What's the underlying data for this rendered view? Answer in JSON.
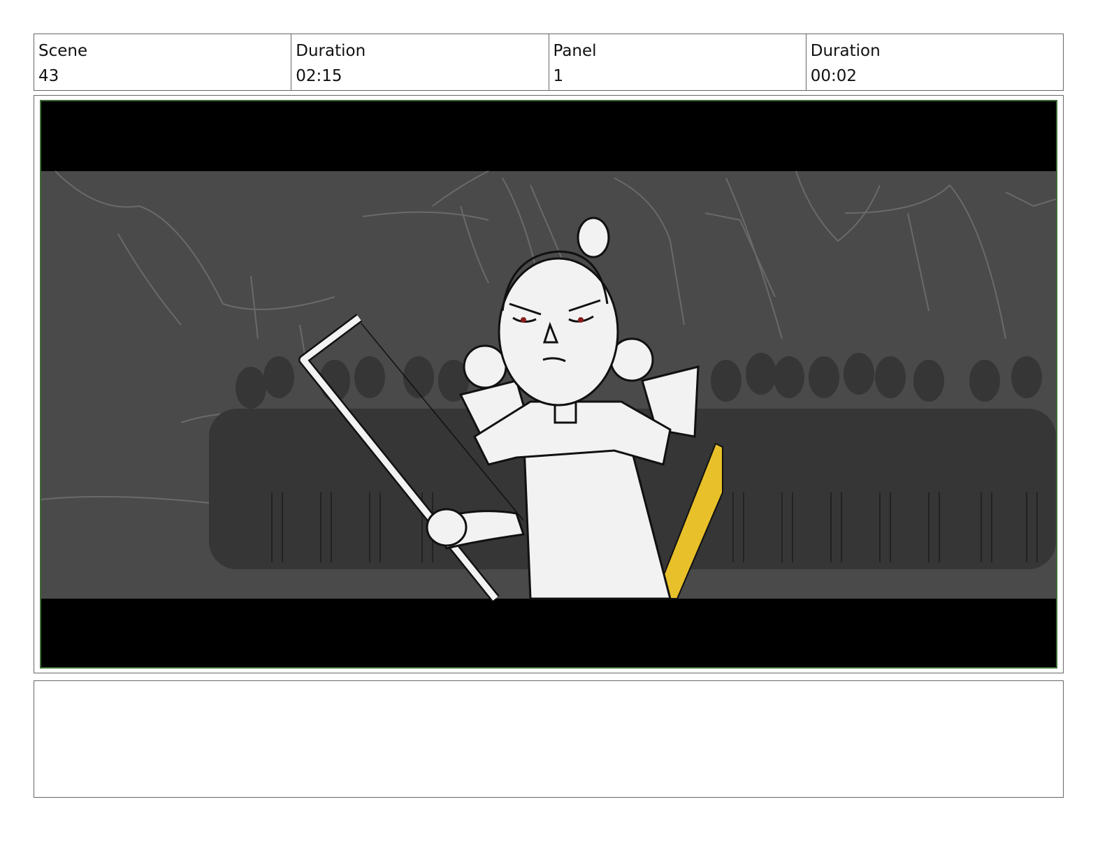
{
  "header": {
    "scene_label": "Scene",
    "scene_value": "43",
    "scene_duration_label": "Duration",
    "scene_duration_value": "02:15",
    "panel_label": "Panel",
    "panel_value": "1",
    "panel_duration_label": "Duration",
    "panel_duration_value": "00:02"
  },
  "panel": {
    "frame_border_color": "#3d6b35",
    "letterbox_color": "#000000",
    "background_color": "#4a4a4a",
    "crowd_color": "#2e2e2e",
    "accent_color": "#e8c02a"
  },
  "notes": {
    "text": ""
  }
}
